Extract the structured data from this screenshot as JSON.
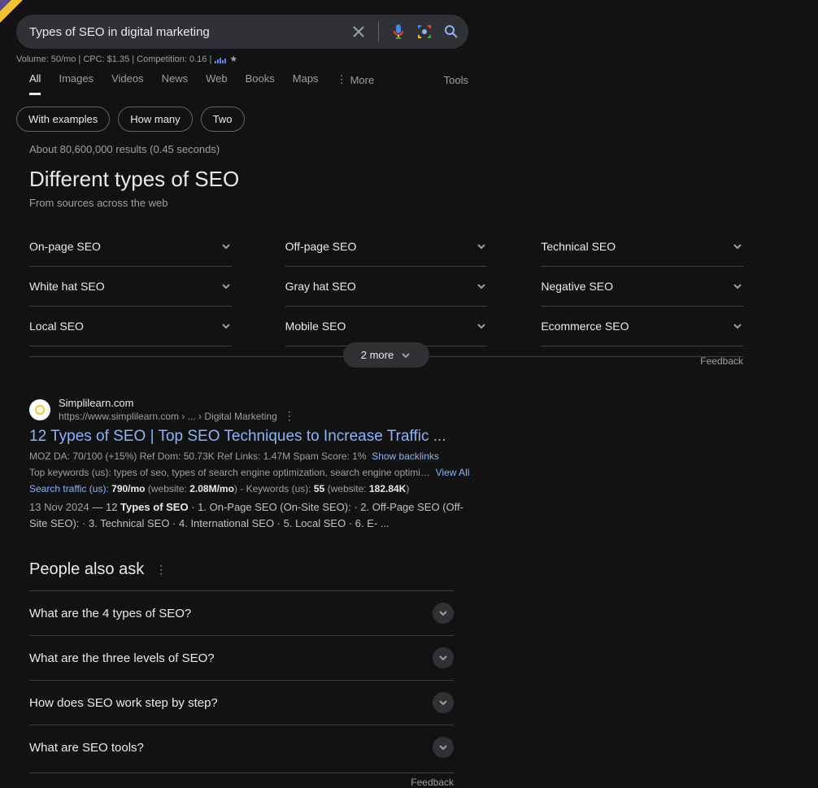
{
  "search": {
    "query": "Types of SEO in digital marketing",
    "meta": "Volume: 50/mo | CPC: $1.35 | Competition: 0.16 |"
  },
  "tabs": [
    "All",
    "Images",
    "Videos",
    "News",
    "Web",
    "Books",
    "Maps"
  ],
  "more_label": "More",
  "tools_label": "Tools",
  "chips": [
    "With examples",
    "How many",
    "Two"
  ],
  "results_info": "About 80,600,000 results (0.45 seconds)",
  "section": {
    "heading": "Different types of SEO",
    "sub": "From sources across the web",
    "items": [
      "On-page SEO",
      "Off-page SEO",
      "Technical SEO",
      "White hat SEO",
      "Gray hat SEO",
      "Negative SEO",
      "Local SEO",
      "Mobile SEO",
      "Ecommerce SEO"
    ],
    "more": "2 more",
    "feedback": "Feedback"
  },
  "result1": {
    "site": "Simplilearn.com",
    "url": "https://www.simplilearn.com › ... › Digital Marketing",
    "title": "12 Types of SEO | Top SEO Techniques to Increase Traffic ...",
    "moz": "MOZ DA: 70/100 (+15%)   Ref Dom: 50.73K   Ref Links: 1.47M   Spam Score: 1%",
    "backlinks": "Show backlinks",
    "kw_prefix": "Top keywords (us): types of seo, types of search engine optimization, search engine optimi…",
    "viewall": "View All",
    "traffic_label": "Search traffic (us):",
    "traffic_val": "790/mo",
    "traffic_site": "(website: ",
    "traffic_site_val": "2.08M/mo",
    "kw_label": ") - Keywords (us): ",
    "kw_val": "55",
    "kw_site": " (website: ",
    "kw_site_val": "182.84K",
    "kw_close": ")",
    "date": "13 Nov 2024",
    "snippet_part1": " — 12 ",
    "snippet_bold1": "Types of SEO",
    "snippet_part2": " · 1. On-Page SEO (On-Site SEO): · 2. Off-Page SEO (Off-Site SEO): · 3. Technical SEO · 4. International SEO · 5. Local SEO · 6. E- ..."
  },
  "paa": {
    "title": "People also ask",
    "items": [
      "What are the 4 types of SEO?",
      "What are the three levels of SEO?",
      "How does SEO work step by step?",
      "What are SEO tools?"
    ],
    "feedback": "Feedback"
  }
}
